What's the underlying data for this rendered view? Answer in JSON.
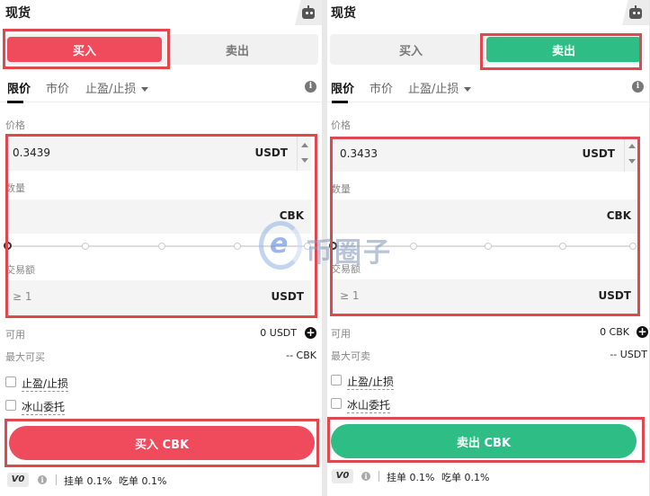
{
  "colors": {
    "buy": "#f04a5d",
    "sell": "#2ebd85",
    "highlight": "#e0474f"
  },
  "watermark": {
    "text": "币圈子"
  },
  "panels": {
    "left": {
      "title": "现货",
      "tabs": {
        "buy": "买入",
        "sell": "卖出",
        "active": "buy"
      },
      "order_types": {
        "limit": "限价",
        "market": "市价",
        "tpsl": "止盈/止损"
      },
      "price": {
        "label": "价格",
        "value": "0.3439",
        "unit": "USDT"
      },
      "amount": {
        "label": "数量",
        "value": "",
        "unit": "CBK"
      },
      "total": {
        "label": "交易额",
        "placeholder": "≥ 1",
        "unit": "USDT"
      },
      "available": {
        "label": "可用",
        "value": "0 USDT"
      },
      "max": {
        "label": "最大可买",
        "value": "-- CBK"
      },
      "options": {
        "tpsl": "止盈/止损",
        "iceberg": "冰山委托"
      },
      "submit": "买入 CBK",
      "fee": {
        "level": "V0",
        "maker": "挂单 0.1%",
        "taker": "吃单 0.1%"
      }
    },
    "right": {
      "title": "现货",
      "tabs": {
        "buy": "买入",
        "sell": "卖出",
        "active": "sell"
      },
      "order_types": {
        "limit": "限价",
        "market": "市价",
        "tpsl": "止盈/止损"
      },
      "price": {
        "label": "价格",
        "value": "0.3433",
        "unit": "USDT"
      },
      "amount": {
        "label": "数量",
        "value": "",
        "unit": "CBK"
      },
      "total": {
        "label": "交易额",
        "placeholder": "≥ 1",
        "unit": "USDT"
      },
      "available": {
        "label": "可用",
        "value": "0 CBK"
      },
      "max": {
        "label": "最大可卖",
        "value": "-- USDT"
      },
      "options": {
        "tpsl": "止盈/止损",
        "iceberg": "冰山委托"
      },
      "submit": "卖出 CBK",
      "fee": {
        "level": "V0",
        "maker": "挂单 0.1%",
        "taker": "吃单 0.1%"
      }
    }
  }
}
